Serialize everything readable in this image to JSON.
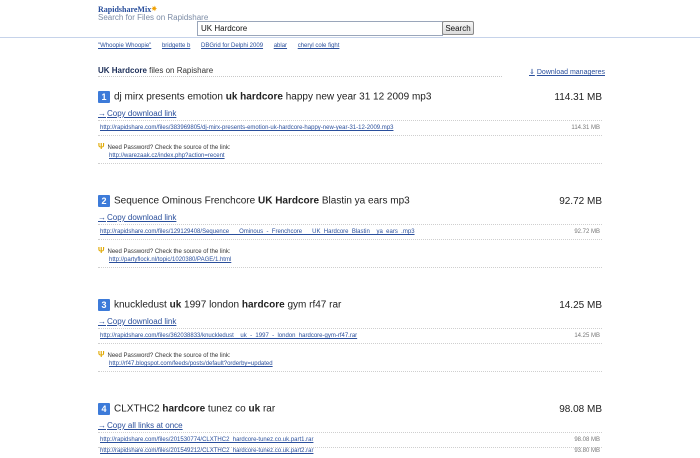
{
  "header": {
    "logo": "RapidshareMix",
    "tagline": "Search for Files on Rapidshare",
    "search_value": "UK Hardcore",
    "search_button": "Search"
  },
  "related": [
    "\"Whoopie Whoopie\"",
    "bridgette b",
    "DBGrid for Delphi 2009",
    "ablar",
    "cheryl cole fight"
  ],
  "section": {
    "query": "UK Hardcore",
    "suffix": " files on Rapishare",
    "download_managers": "Download manageres"
  },
  "results": [
    {
      "num": "1",
      "title": "dj mirx presents emotion uk hardcore happy new year 31 12 2009 mp3",
      "size": "114.31 MB",
      "copy_label": "Copy download link",
      "links": [
        {
          "url": "http://rapidshare.com/files/383969805/dj-mirx-presents-emotion-uk-hardcore-happy-new-year-31-12-2009.mp3",
          "size": "114.31 MB"
        }
      ],
      "password_text": "Need Password? Check the source of the link:",
      "source_url": "http://warezaak.cz/index.php?action=recent"
    },
    {
      "num": "2",
      "title": "Sequence Ominous Frenchcore UK Hardcore Blastin ya ears mp3",
      "size": "92.72 MB",
      "copy_label": "Copy download link",
      "links": [
        {
          "url": "http://rapidshare.com/files/129129408/Sequence___Ominous_-_Frenchcore___UK_Hardcore_Blastin__ya_ears_.mp3",
          "size": "92.72 MB"
        }
      ],
      "password_text": "Need Password? Check the source of the link:",
      "source_url": "http://partyflock.nl/topic/1020380/PAGE/1.html"
    },
    {
      "num": "3",
      "title": "knuckledust uk 1997 london hardcore gym rf47 rar",
      "size": "14.25 MB",
      "copy_label": "Copy download link",
      "links": [
        {
          "url": "http://rapidshare.com/files/362038833/knuckledust__uk_-_1997_-_london_hardcore-gym-rf47.rar",
          "size": "14.25 MB"
        }
      ],
      "password_text": "Need Password? Check the source of the link:",
      "source_url": "http://rf47.blogspot.com/feeds/posts/default?orderby=updated"
    },
    {
      "num": "4",
      "title": "CLXTHC2 hardcore tunez co uk rar",
      "size": "98.08 MB",
      "copy_label": "Copy all links at once",
      "links": [
        {
          "url": "http://rapidshare.com/files/201530774/CLXTHC2_hardcore-tunez.co.uk.part1.rar",
          "size": "98.08 MB"
        },
        {
          "url": "http://rapidshare.com/files/201549212/CLXTHC2_hardcore-tunez.co.uk.part2.rar",
          "size": "93.80 MB"
        }
      ]
    }
  ]
}
